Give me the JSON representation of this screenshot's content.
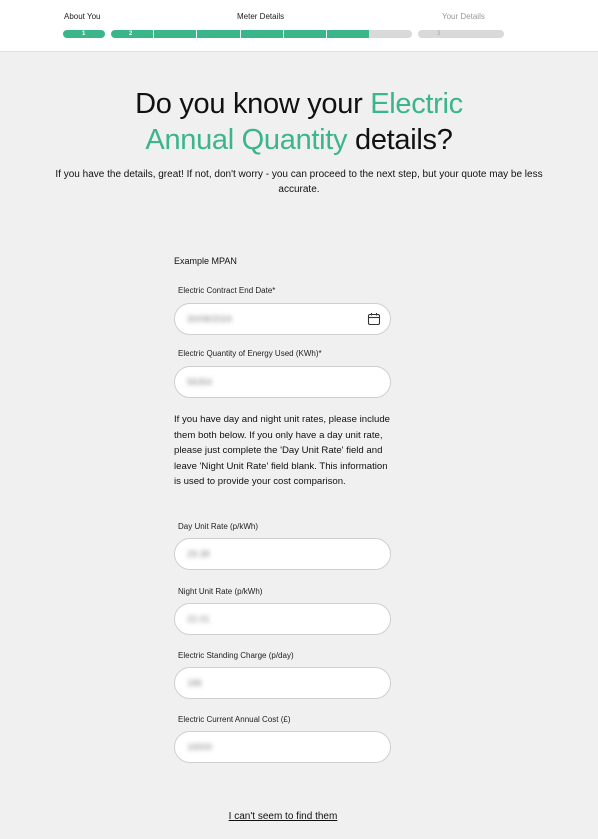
{
  "progress": {
    "steps": [
      {
        "label": "About You",
        "number": "1",
        "state": "complete"
      },
      {
        "label": "Meter Details",
        "number": "2",
        "state": "active"
      },
      {
        "label": "Your Details",
        "number": "3",
        "state": "pending"
      }
    ],
    "accent_color": "#3bb58a",
    "pending_color": "#d9d9d9"
  },
  "heading": {
    "line1_plain": "Do you know your ",
    "line1_accent": "Electric",
    "line2_accent": "Annual Quantity",
    "line2_plain": " details?"
  },
  "subtitle": "If you have the details, great! If not, don't worry - you can proceed to the next step, but your quote may be less accurate.",
  "form": {
    "mpan_label": "Example MPAN",
    "contract_end_label": "Electric Contract End Date*",
    "contract_end_value": "30/08/2024",
    "quantity_label": "Electric Quantity of Energy Used (KWh)*",
    "quantity_value": "56354",
    "info_text": "If you have day and night unit rates, please include them both below. If you only have a day unit rate, please just complete the 'Day Unit Rate' field and leave 'Night Unit Rate' field blank. This information is used to provide your cost comparison.",
    "day_rate_label": "Day Unit Rate (p/kWh)",
    "day_rate_value": "29.38",
    "night_rate_label": "Night Unit Rate (p/kWh)",
    "night_rate_value": "22.01",
    "standing_label": "Electric Standing Charge (p/day)",
    "standing_value": "186",
    "annual_cost_label": "Electric Current Annual Cost (£)",
    "annual_cost_value": "16500"
  },
  "find_link": "I can't seem to find them"
}
